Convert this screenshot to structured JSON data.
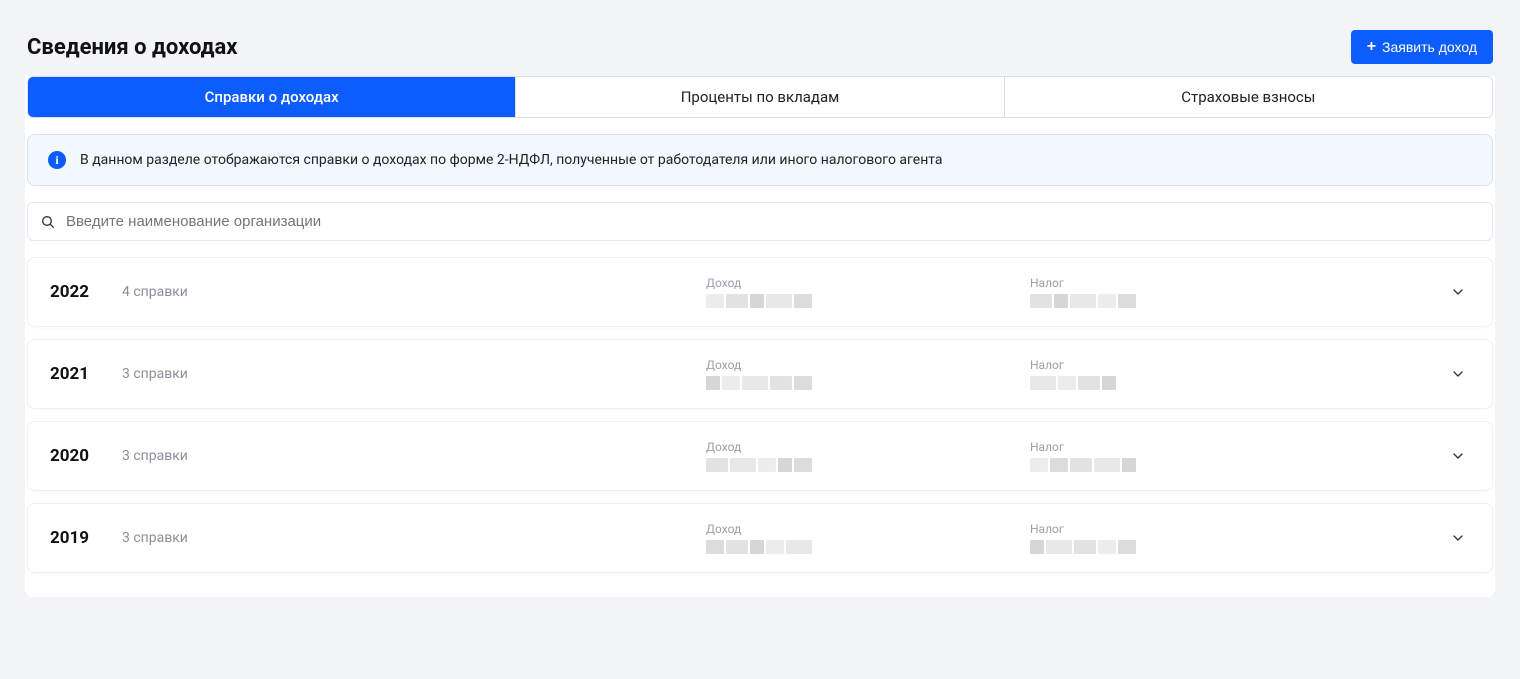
{
  "page": {
    "title": "Сведения о доходах"
  },
  "actions": {
    "declare_income": "Заявить доход"
  },
  "tabs": [
    {
      "label": "Справки о доходах",
      "active": true
    },
    {
      "label": "Проценты по вкладам",
      "active": false
    },
    {
      "label": "Страховые взносы",
      "active": false
    }
  ],
  "info": {
    "text": "В данном разделе отображаются справки о доходах по форме 2-НДФЛ, полученные от работодателя или иного налогового агента"
  },
  "search": {
    "placeholder": "Введите наименование организации"
  },
  "labels": {
    "income": "Доход",
    "tax": "Налог"
  },
  "rows": [
    {
      "year": "2022",
      "count": "4 справки"
    },
    {
      "year": "2021",
      "count": "3 справки"
    },
    {
      "year": "2020",
      "count": "3 справки"
    },
    {
      "year": "2019",
      "count": "3 справки"
    }
  ]
}
